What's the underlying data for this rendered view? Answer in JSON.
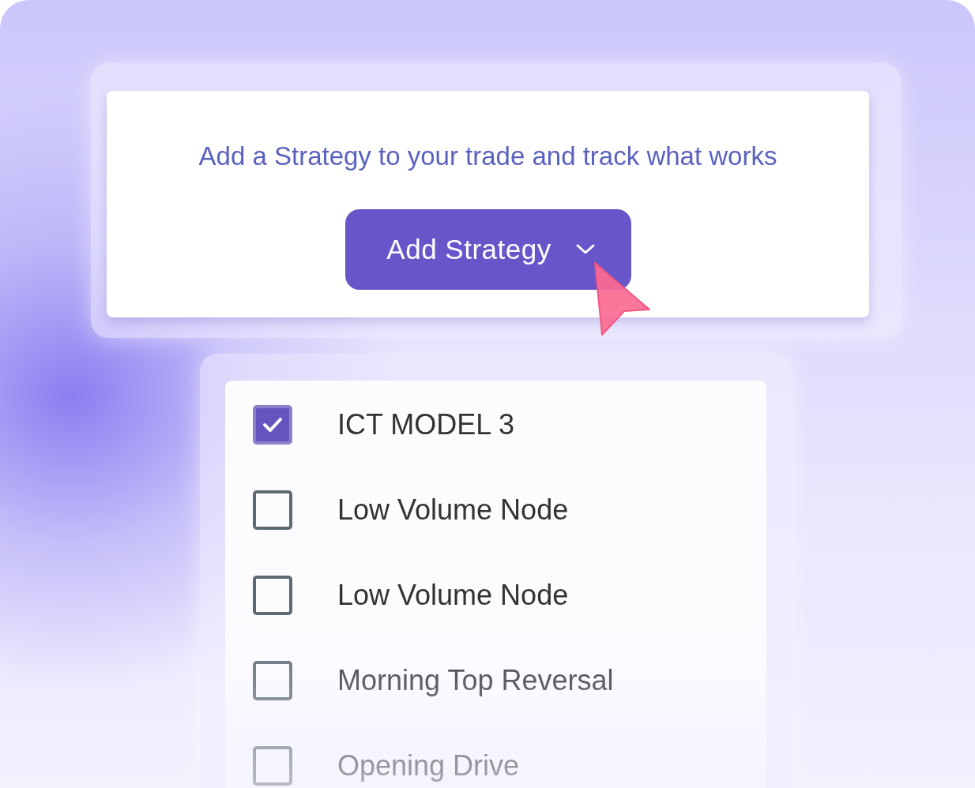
{
  "prompt": {
    "text": "Add a Strategy to your trade and track what works"
  },
  "button": {
    "label": "Add Strategy"
  },
  "strategies": [
    {
      "label": "ICT MODEL 3",
      "checked": true
    },
    {
      "label": "Low Volume Node",
      "checked": false
    },
    {
      "label": "Low Volume Node",
      "checked": false
    },
    {
      "label": "Morning Top Reversal",
      "checked": false
    },
    {
      "label": "Opening Drive",
      "checked": false
    }
  ]
}
